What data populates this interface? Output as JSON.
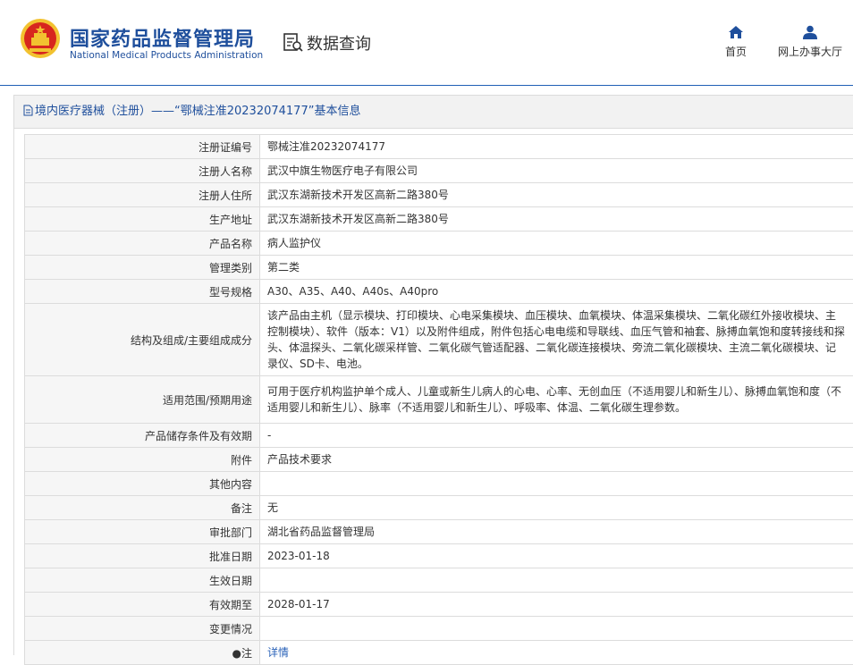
{
  "header": {
    "logo_cn": "国家药品监督管理局",
    "logo_en": "National Medical Products Administration",
    "page_title": "数据查询",
    "nav": [
      {
        "label": "首页",
        "icon": "home-icon"
      },
      {
        "label": "网上办事大厅",
        "icon": "user-icon"
      }
    ]
  },
  "panel": {
    "title": "境内医疗器械（注册）——“鄂械注准20232074177”基本信息"
  },
  "rows": [
    {
      "label": "注册证编号",
      "value": "鄂械注准20232074177",
      "h": 1
    },
    {
      "label": "注册人名称",
      "value": "武汉中旗生物医疗电子有限公司",
      "h": 1
    },
    {
      "label": "注册人住所",
      "value": "武汉东湖新技术开发区高新二路380号",
      "h": 1
    },
    {
      "label": "生产地址",
      "value": "武汉东湖新技术开发区高新二路380号",
      "h": 1
    },
    {
      "label": "产品名称",
      "value": "病人监护仪",
      "h": 1
    },
    {
      "label": "管理类别",
      "value": "第二类",
      "h": 1
    },
    {
      "label": "型号规格",
      "value": "A30、A35、A40、A40s、A40pro",
      "h": 1
    },
    {
      "label": "结构及组成/主要组成成分",
      "value": "该产品由主机（显示模块、打印模块、心电采集模块、血压模块、血氧模块、体温采集模块、二氧化碳红外接收模块、主控制模块）、软件（版本：V1）以及附件组成，附件包括心电电缆和导联线、血压气管和袖套、脉搏血氧饱和度转接线和探头、体温探头、二氧化碳采样管、二氧化碳气管适配器、二氧化碳连接模块、旁流二氧化碳模块、主流二氧化碳模块、记录仪、SD卡、电池。",
      "h": 3
    },
    {
      "label": "适用范围/预期用途",
      "value": "可用于医疗机构监护单个成人、儿童或新生儿病人的心电、心率、无创血压（不适用婴儿和新生儿）、脉搏血氧饱和度（不适用婴儿和新生儿）、脉率（不适用婴儿和新生儿）、呼吸率、体温、二氧化碳生理参数。",
      "h": 2
    },
    {
      "label": "产品储存条件及有效期",
      "value": "-",
      "h": 1
    },
    {
      "label": "附件",
      "value": "产品技术要求",
      "h": 1
    },
    {
      "label": "其他内容",
      "value": "",
      "h": 1
    },
    {
      "label": "备注",
      "value": "无",
      "h": 1
    },
    {
      "label": "审批部门",
      "value": "湖北省药品监督管理局",
      "h": 1
    },
    {
      "label": "批准日期",
      "value": "2023-01-18",
      "h": 1
    },
    {
      "label": "生效日期",
      "value": "",
      "h": 1
    },
    {
      "label": "有效期至",
      "value": "2028-01-17",
      "h": 1
    },
    {
      "label": "变更情况",
      "value": "",
      "h": 1
    },
    {
      "label": "●注",
      "value": "详情",
      "h": 1,
      "link": true
    }
  ],
  "colors": {
    "brand_blue": "#1f4f9c",
    "link_blue": "#2a62b8",
    "border": "#dcdcdc",
    "label_bg": "#f6f6f6",
    "emblem_red": "#d7261e",
    "emblem_gold": "#f2c230"
  }
}
